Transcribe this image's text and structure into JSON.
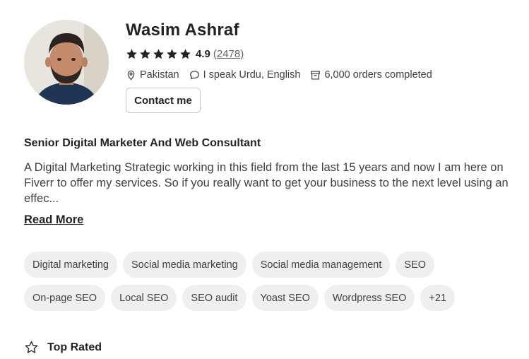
{
  "profile": {
    "name": "Wasim Ashraf",
    "rating_value": "4.9",
    "rating_count": "(2478)",
    "location": "Pakistan",
    "languages": "I speak Urdu, English",
    "orders": "6,000 orders completed",
    "contact_label": "Contact me"
  },
  "about": {
    "headline": "Senior Digital Marketer And Web Consultant",
    "bio": "A Digital Marketing Strategic working in this field from the last 15 years and now I am here on Fiverr to offer my services. So if you really want to get your business to the next level using an effec...",
    "read_more": "Read More"
  },
  "skills": {
    "row1": [
      "Digital marketing",
      "Social media marketing",
      "Social media management",
      "SEO"
    ],
    "row2": [
      "On-page SEO",
      "Local SEO",
      "SEO audit",
      "Yoast SEO",
      "Wordpress SEO",
      "+21"
    ]
  },
  "badge": {
    "label": "Top Rated",
    "icon": "star-outline-icon"
  },
  "colors": {
    "text_dark": "#222325",
    "text_body": "#404145",
    "chip_bg": "#efeff0",
    "star": "#222325"
  }
}
